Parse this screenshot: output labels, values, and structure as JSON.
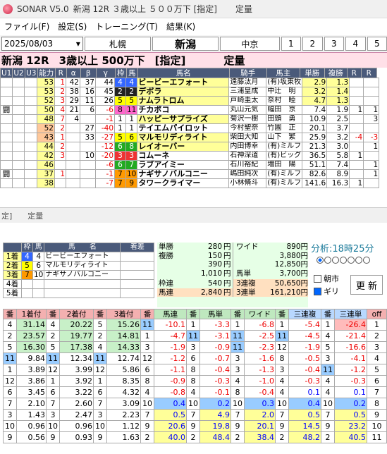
{
  "app": {
    "title": "SONAR V5.0",
    "race_title": "新潟 12R ３歳以上 ５００万下 [指定]",
    "status": "定量"
  },
  "menu": [
    "ファイル(F)",
    "設定(S)",
    "トレーニング(T)",
    "結果(K)"
  ],
  "toolbar": {
    "date": "2025/08/03",
    "venues": [
      "札幌",
      "新潟",
      "中京"
    ],
    "selected_venue": "新潟",
    "races": [
      "1",
      "2",
      "3",
      "4",
      "5"
    ]
  },
  "race": {
    "venue_race": "新潟 12R",
    "cond": "3歳以上 500万下",
    "tag": "[指定]",
    "weight": "定量"
  },
  "main_headers": [
    "U1",
    "U2",
    "U3",
    "能力",
    "R",
    "α",
    "β",
    "γ",
    "枠",
    "馬",
    "馬名",
    "騎手",
    "馬主",
    "単勝",
    "複勝",
    "R",
    "R"
  ],
  "runners": [
    {
      "u1": "",
      "u2": "",
      "u3": "",
      "ab": "53",
      "r": "1",
      "a": "42",
      "b": "37",
      "g": "44",
      "waku": "4",
      "uma": "4",
      "name": "ビービーエフォート",
      "jk": "遠藤汰月",
      "own": "(有)坂東牧",
      "tan": "2.9",
      "fuku": "1.3",
      "r1": "",
      "r2": ""
    },
    {
      "u1": "",
      "u2": "",
      "u3": "",
      "ab": "53",
      "r": "2",
      "a": "38",
      "b": "16",
      "g": "45",
      "waku": "2",
      "uma": "2",
      "name": "デボラ",
      "jk": "三浦皇成",
      "own": "中辻　明",
      "tan": "3.2",
      "fuku": "1.4",
      "r1": "",
      "r2": ""
    },
    {
      "u1": "",
      "u2": "",
      "u3": "",
      "ab": "52",
      "r": "3",
      "a": "29",
      "b": "11",
      "g": "26",
      "waku": "5",
      "uma": "5",
      "name": "ナムラトロム",
      "jk": "戸崎圭太",
      "own": "奈村　睦",
      "tan": "4.7",
      "fuku": "1.3",
      "r1": "",
      "r2": ""
    },
    {
      "u1": "闘",
      "u2": "",
      "u3": "",
      "ab": "50",
      "r": "4",
      "a": "21",
      "b": "6",
      "g": "-6",
      "waku": "8",
      "uma": "11",
      "name": "チカポコ",
      "jk": "丸山元気",
      "own": "幅田　京",
      "tan": "7.4",
      "fuku": "1.9",
      "r1": "1",
      "r2": "1"
    },
    {
      "u1": "",
      "u2": "",
      "u3": "",
      "ab": "48",
      "r": "7",
      "a": "4",
      "b": "",
      "g": "-1",
      "waku": "1",
      "uma": "1",
      "name": "ハッピーサプライズ",
      "jk": "菊沢一樹",
      "own": "田頭　勇",
      "tan": "10.9",
      "fuku": "2.5",
      "r1": "",
      "r2": "3"
    },
    {
      "u1": "",
      "u2": "",
      "u3": "",
      "ab": "52",
      "r": "2",
      "a": "",
      "b": "27",
      "g": "-40",
      "waku": "1",
      "uma": "1",
      "name": "テイエムパイロット",
      "jk": "今村聖奈",
      "own": "竹園　正",
      "tan": "20.1",
      "fuku": "3.7",
      "r1": "",
      "r2": ""
    },
    {
      "u1": "",
      "u2": "",
      "u3": "",
      "ab": "43",
      "r": "1",
      "a": "",
      "b": "33",
      "g": "-27",
      "waku": "5",
      "uma": "6",
      "name": "マルモリディライト",
      "jk": "柴田大知",
      "own": "山下　繁",
      "tan": "25.9",
      "fuku": "3.2",
      "r1": "-4",
      "r2": "-3"
    },
    {
      "u1": "",
      "u2": "",
      "u3": "",
      "ab": "44",
      "r": "2",
      "a": "",
      "b": "",
      "g": "-12",
      "waku": "6",
      "uma": "8",
      "name": "レイオーバー",
      "jk": "内田博幸",
      "own": "(有)ミルフ",
      "tan": "21.3",
      "fuku": "3.0",
      "r1": "",
      "r2": "1"
    },
    {
      "u1": "",
      "u2": "",
      "u3": "",
      "ab": "42",
      "r": "3",
      "a": "",
      "b": "10",
      "g": "-20",
      "waku": "3",
      "uma": "3",
      "name": "コムーネ",
      "jk": "石神深道",
      "own": "(有)ビッグ",
      "tan": "36.5",
      "fuku": "5.8",
      "r1": "1",
      "r2": ""
    },
    {
      "u1": "",
      "u2": "",
      "u3": "",
      "ab": "46",
      "r": "",
      "a": "",
      "b": "",
      "g": "-6",
      "waku": "6",
      "uma": "7",
      "name": "ラブアイミー",
      "jk": "石川裕紀",
      "own": "増田　陽",
      "tan": "51.1",
      "fuku": "7.4",
      "r1": "",
      "r2": "1"
    },
    {
      "u1": "闘",
      "u2": "",
      "u3": "",
      "ab": "37",
      "r": "1",
      "a": "",
      "b": "",
      "g": "-1",
      "waku": "7",
      "uma": "10",
      "name": "ナギサノバルコニー",
      "jk": "嶋田純次",
      "own": "(有)ミルフ",
      "tan": "82.6",
      "fuku": "8.9",
      "r1": "",
      "r2": "1"
    },
    {
      "u1": "",
      "u2": "",
      "u3": "",
      "ab": "38",
      "r": "",
      "a": "",
      "b": "",
      "g": "-7",
      "waku": "7",
      "uma": "9",
      "name": "タワークライマー",
      "jk": "小林脩斗",
      "own": "(有)ミルフ",
      "tan": "141.6",
      "fuku": "16.3",
      "r1": "1",
      "r2": ""
    }
  ],
  "sep": {
    "left": "定]",
    "right": "定量"
  },
  "result_headers": [
    "",
    "枠",
    "馬",
    "馬　　名",
    "着差"
  ],
  "results": [
    {
      "pos": "1着",
      "waku": "4",
      "uma": "4",
      "name": "ビービーエフォート",
      "diff": ""
    },
    {
      "pos": "2着",
      "waku": "5",
      "uma": "6",
      "name": "マルモリディライト",
      "diff": ""
    },
    {
      "pos": "3着",
      "waku": "7",
      "uma": "10",
      "name": "ナギサノバルコニー",
      "diff": ""
    },
    {
      "pos": "4着",
      "waku": "",
      "uma": "",
      "name": "",
      "diff": ""
    },
    {
      "pos": "5着",
      "waku": "",
      "uma": "",
      "name": "",
      "diff": ""
    }
  ],
  "payout": {
    "tan": {
      "label": "単勝",
      "v": "280",
      "u": "円"
    },
    "fuku": {
      "label": "複勝",
      "v": [
        "150",
        "390",
        "1,010"
      ],
      "u": "円"
    },
    "wakuren": {
      "label": "枠連",
      "v": "540",
      "u": "円"
    },
    "umaren": {
      "label": "馬連",
      "v": "2,840",
      "u": "円"
    },
    "wide": {
      "label": "ワイド",
      "v": [
        "890",
        "3,880",
        "12,850"
      ],
      "u": "円"
    },
    "umatan": {
      "label": "馬単",
      "v": "3,700",
      "u": "円"
    },
    "sanrenpuku": {
      "label": "3連複",
      "v": "50,650",
      "u": "円"
    },
    "sanrentan": {
      "label": "3連単",
      "v": "161,210",
      "u": "円"
    }
  },
  "analysis": {
    "label": "分析:18時25分",
    "chk1": "朝市",
    "chk2": "ギリ",
    "update": "更 新"
  },
  "odds_headers": [
    "番",
    "1着付",
    "番",
    "2着付",
    "番",
    "3着付",
    "番",
    "馬連",
    "番",
    "馬単",
    "番",
    "ワイド",
    "番",
    "三連複",
    "番",
    "三連単",
    "off"
  ],
  "odds_rows": [
    {
      "n1": "4",
      "o1": "31.14",
      "n2": "4",
      "o2": "20.22",
      "n3": "5",
      "o3": "15.26",
      "n4": "11",
      "o4": "-10.1",
      "n5": "1",
      "o5": "-3.3",
      "n6": "1",
      "o6": "-6.8",
      "n7": "1",
      "o7": "-5.4",
      "n8": "1",
      "o8": "-26.4",
      "off": "1"
    },
    {
      "n1": "2",
      "o1": "23.57",
      "n2": "2",
      "o2": "19.77",
      "n3": "2",
      "o3": "14.81",
      "n4": "1",
      "o4": "-4.7",
      "n5": "11",
      "o5": "-3.1",
      "n6": "11",
      "o6": "-2.5",
      "n7": "11",
      "o7": "-4.5",
      "n8": "4",
      "o8": "-21.4",
      "off": "2"
    },
    {
      "n1": "5",
      "o1": "16.30",
      "n2": "5",
      "o2": "17.38",
      "n3": "4",
      "o3": "14.33",
      "n4": "3",
      "o4": "-1.9",
      "n5": "3",
      "o5": "-0.9",
      "n6": "11",
      "o6": "-2.3",
      "n7": "12",
      "o7": "-1.9",
      "n8": "5",
      "o8": "-16.6",
      "off": "3"
    },
    {
      "n1": "11",
      "o1": "9.84",
      "n2": "11",
      "o2": "12.34",
      "n3": "11",
      "o3": "12.74",
      "n4": "12",
      "o4": "-1.2",
      "n5": "6",
      "o5": "-0.7",
      "n6": "3",
      "o6": "-1.6",
      "n7": "8",
      "o7": "-0.5",
      "n8": "3",
      "o8": "-4.1",
      "off": "4"
    },
    {
      "n1": "1",
      "o1": "3.89",
      "n2": "12",
      "o2": "3.99",
      "n3": "12",
      "o3": "5.86",
      "n4": "6",
      "o4": "-1.1",
      "n5": "8",
      "o5": "-0.4",
      "n6": "3",
      "o6": "-1.3",
      "n7": "3",
      "o7": "-0.4",
      "n8": "11",
      "o8": "-1.2",
      "off": "5"
    },
    {
      "n1": "12",
      "o1": "3.86",
      "n2": "1",
      "o2": "3.92",
      "n3": "1",
      "o3": "8.35",
      "n4": "8",
      "o4": "-0.9",
      "n5": "8",
      "o5": "-0.3",
      "n6": "4",
      "o6": "-1.0",
      "n7": "4",
      "o7": "-0.3",
      "n8": "4",
      "o8": "-0.3",
      "off": "6"
    },
    {
      "n1": "6",
      "o1": "3.45",
      "n2": "6",
      "o2": "3.22",
      "n3": "6",
      "o3": "4.32",
      "n4": "4",
      "o4": "-0.8",
      "n5": "4",
      "o5": "-0.1",
      "n6": "8",
      "o6": "-0.4",
      "n7": "4",
      "o7": "0.1",
      "n8": "4",
      "o8": "0.1",
      "off": "7"
    },
    {
      "n1": "7",
      "o1": "2.10",
      "n2": "7",
      "o2": "2.60",
      "n3": "7",
      "o3": "3.09",
      "n4": "10",
      "o4": "0.4",
      "n5": "10",
      "o5": "0.2",
      "n6": "10",
      "o6": "0.3",
      "n7": "10",
      "o7": "0.4",
      "n8": "10",
      "o8": "0.2",
      "off": "8"
    },
    {
      "n1": "3",
      "o1": "1.43",
      "n2": "3",
      "o2": "2.47",
      "n3": "3",
      "o3": "2.23",
      "n4": "7",
      "o4": "0.5",
      "n5": "7",
      "o5": "4.9",
      "n6": "7",
      "o6": "2.0",
      "n7": "7",
      "o7": "0.5",
      "n8": "7",
      "o8": "0.5",
      "off": "9"
    },
    {
      "n1": "10",
      "o1": "0.96",
      "n2": "10",
      "o2": "0.96",
      "n3": "10",
      "o3": "1.12",
      "n4": "9",
      "o4": "20.6",
      "n5": "9",
      "o5": "19.8",
      "n6": "9",
      "o6": "20.1",
      "n7": "9",
      "o7": "14.5",
      "n8": "9",
      "o8": "23.2",
      "off": "10"
    },
    {
      "n1": "9",
      "o1": "0.56",
      "n2": "9",
      "o2": "0.93",
      "n3": "9",
      "o3": "1.63",
      "n4": "2",
      "o4": "40.0",
      "n5": "2",
      "o5": "48.4",
      "n6": "2",
      "o6": "38.4",
      "n7": "2",
      "o7": "48.2",
      "n8": "2",
      "o8": "40.5",
      "off": "11"
    }
  ]
}
